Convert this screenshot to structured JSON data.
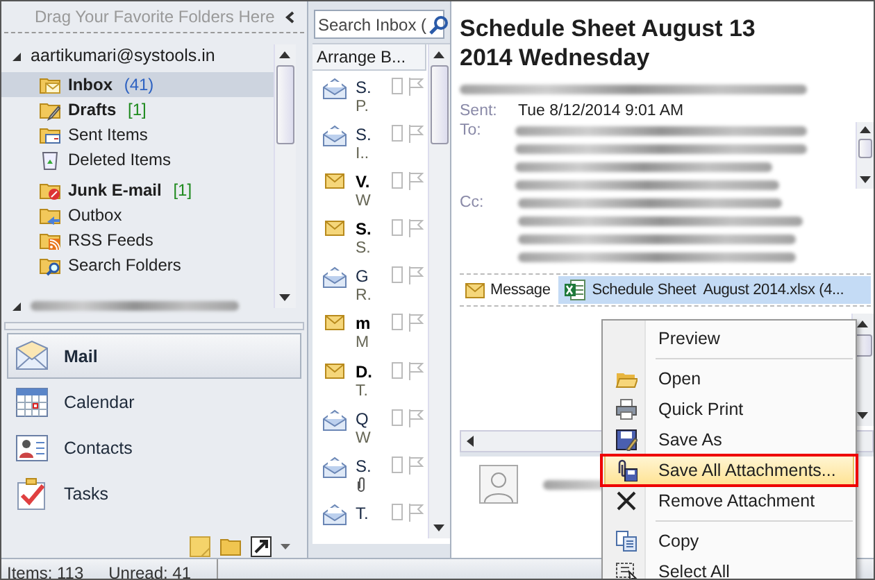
{
  "favorites_bar": {
    "hint": "Drag Your Favorite Folders Here"
  },
  "account": {
    "name": "aartikumari@systools.in",
    "expanded": true
  },
  "folder_groups": [
    [
      {
        "kind": "inbox",
        "name": "Inbox",
        "count": "(41)",
        "color": "#2f63c2",
        "unread": true,
        "selected": true
      },
      {
        "kind": "drafts",
        "name": "Drafts",
        "count": "[1]",
        "color": "#1e8a1e",
        "unread": true,
        "selected": false
      },
      {
        "kind": "sent",
        "name": "Sent Items",
        "unread": false,
        "selected": false
      },
      {
        "kind": "deleted",
        "name": "Deleted Items",
        "unread": false,
        "selected": false
      }
    ],
    [
      {
        "kind": "junk",
        "name": "Junk E-mail",
        "count": "[1]",
        "color": "#1e8a1e",
        "unread": true,
        "selected": false
      },
      {
        "kind": "outbox",
        "name": "Outbox",
        "unread": false,
        "selected": false
      },
      {
        "kind": "rss",
        "name": "RSS Feeds",
        "unread": false,
        "selected": false
      },
      {
        "kind": "search",
        "name": "Search Folders",
        "unread": false,
        "selected": false
      }
    ]
  ],
  "second_account": {
    "expanded": true
  },
  "nav": [
    {
      "kind": "mail",
      "label": "Mail",
      "selected": true
    },
    {
      "kind": "calendar",
      "label": "Calendar",
      "selected": false
    },
    {
      "kind": "contacts",
      "label": "Contacts",
      "selected": false
    },
    {
      "kind": "tasks",
      "label": "Tasks",
      "selected": false
    }
  ],
  "status_bar": {
    "items": "Items: 113",
    "unread": "Unread: 41"
  },
  "search": {
    "placeholder": "Search Inbox ("
  },
  "arrange": {
    "label": "Arrange B..."
  },
  "messages": [
    {
      "sender": "S.",
      "subject": "P.",
      "unread": false,
      "attachment": false
    },
    {
      "sender": "S.",
      "subject": "I..",
      "unread": false,
      "attachment": false
    },
    {
      "sender": "V.",
      "subject": "W",
      "unread": true,
      "attachment": false
    },
    {
      "sender": "S.",
      "subject": "S.",
      "unread": true,
      "attachment": false
    },
    {
      "sender": "G",
      "subject": "R.",
      "unread": false,
      "attachment": false
    },
    {
      "sender": "m",
      "subject": "M",
      "unread": true,
      "attachment": false
    },
    {
      "sender": "D.",
      "subject": "T.",
      "unread": true,
      "attachment": false
    },
    {
      "sender": "Q",
      "subject": "W",
      "unread": false,
      "attachment": false
    },
    {
      "sender": "S.",
      "unread": false,
      "attachment": true
    },
    {
      "sender": "T.",
      "unread": false,
      "attachment": false
    }
  ],
  "reading": {
    "subject": "Schedule Sheet August 13 2014 Wednesday",
    "sent_label": "Sent:",
    "sent": "Tue 8/12/2014 9:01 AM",
    "to_label": "To:",
    "cc_label": "Cc:"
  },
  "attachments": [
    {
      "kind": "message",
      "label": "Message",
      "selected": false
    },
    {
      "kind": "excel",
      "label": "Schedule Sheet  August 2014.xlsx (4...",
      "selected": true
    }
  ],
  "context_menu": {
    "items": [
      {
        "kind": "preview",
        "label": "Preview",
        "selected": false,
        "separator_after": true
      },
      {
        "kind": "open",
        "label": "Open",
        "selected": false,
        "separator_after": false
      },
      {
        "kind": "print",
        "label": "Quick Print",
        "selected": false,
        "separator_after": false
      },
      {
        "kind": "save",
        "label": "Save As",
        "selected": false,
        "separator_after": false
      },
      {
        "kind": "save_all",
        "label": "Save All Attachments...",
        "selected": true,
        "separator_after": false
      },
      {
        "kind": "remove",
        "label": "Remove Attachment",
        "selected": false,
        "separator_after": true
      },
      {
        "kind": "copy",
        "label": "Copy",
        "selected": false,
        "separator_after": false
      },
      {
        "kind": "select_all",
        "label": "Select All",
        "selected": false,
        "separator_after": false
      }
    ]
  }
}
